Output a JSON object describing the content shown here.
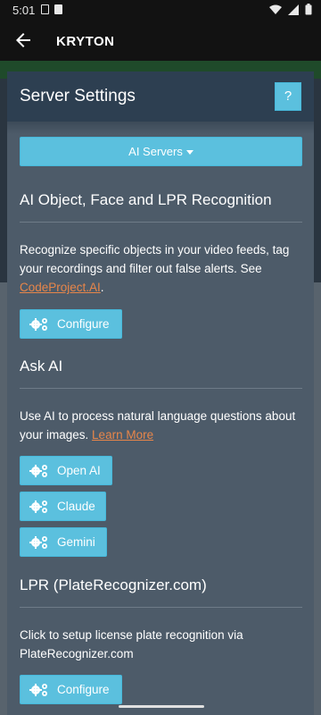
{
  "status_bar": {
    "time": "5:01"
  },
  "app_bar": {
    "title": "KRYTON",
    "back_icon": "arrow-left-icon"
  },
  "modal": {
    "title": "Server Settings",
    "help_label": "?",
    "servers_dropdown": "AI Servers",
    "sections": [
      {
        "title": "AI Object, Face and LPR Recognition",
        "text": "Recognize specific objects in your video feeds, tag your recordings and filter out false alerts. See ",
        "link": "CodeProject.AI",
        "text_after": ".",
        "buttons": [
          "Configure"
        ]
      },
      {
        "title": "Ask AI",
        "text": "Use AI to process natural language questions about your images. ",
        "link": "Learn More",
        "buttons": [
          "Open AI",
          "Claude",
          "Gemini"
        ]
      },
      {
        "title": "LPR (PlateRecognizer.com)",
        "text": "Click to setup license plate recognition via PlateRecognizer.com",
        "buttons": [
          "Configure"
        ]
      }
    ]
  },
  "colors": {
    "accent": "#5bc0de",
    "link": "#e8864a",
    "modal_bg": "#4d5b69",
    "header_bg": "#2d3f51"
  }
}
